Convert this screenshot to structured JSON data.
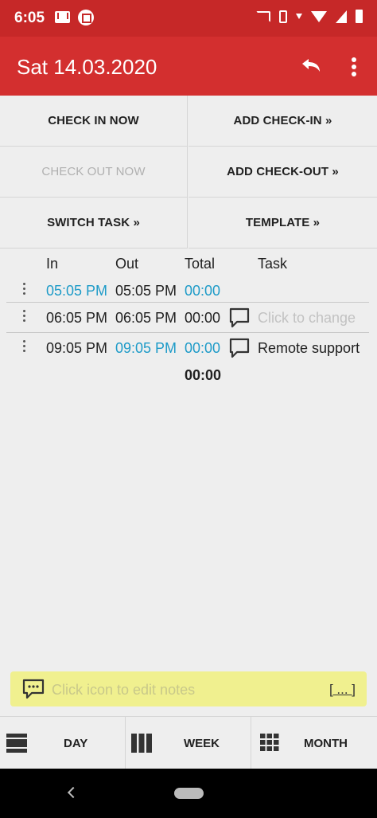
{
  "status_bar": {
    "time": "6:05"
  },
  "app_bar": {
    "title": "Sat 14.03.2020"
  },
  "actions": {
    "check_in_now": "CHECK IN NOW",
    "add_check_in": "ADD CHECK-IN »",
    "check_out_now": "CHECK OUT NOW",
    "add_check_out": "ADD CHECK-OUT »",
    "switch_task": "SWITCH TASK »",
    "template": "TEMPLATE »"
  },
  "table": {
    "headers": {
      "in": "In",
      "out": "Out",
      "total": "Total",
      "task": "Task"
    },
    "rows": [
      {
        "in": "05:05 PM",
        "out": "05:05 PM",
        "total": "00:00",
        "task": ""
      },
      {
        "in": "06:05 PM",
        "out": "06:05 PM",
        "total": "00:00",
        "task": "Click to change"
      },
      {
        "in": "09:05 PM",
        "out": "09:05 PM",
        "total": "00:00",
        "task": "Remote support"
      }
    ],
    "grand_total": "00:00"
  },
  "notes": {
    "placeholder": "Click icon to edit notes",
    "more": "[ ... ]"
  },
  "bottom_nav": {
    "day": "DAY",
    "week": "WEEK",
    "month": "MONTH"
  },
  "colors": {
    "status_bar": "#c62828",
    "app_bar": "#d32f2f",
    "link_blue": "#1e9bc8",
    "notes_bg": "#f0f08f"
  },
  "icons": [
    "gmail-icon",
    "app-notification-icon",
    "cast-icon",
    "vibrate-icon",
    "wifi-icon",
    "signal-icon",
    "battery-icon",
    "undo-icon",
    "more-vert-icon",
    "comment-icon",
    "notes-icon",
    "day-view-icon",
    "week-view-icon",
    "month-view-icon"
  ]
}
